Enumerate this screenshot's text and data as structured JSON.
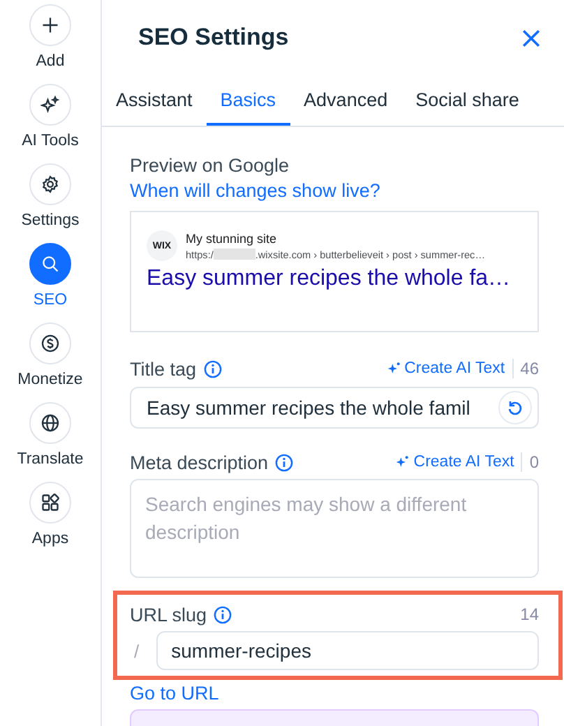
{
  "sidebar": {
    "items": [
      {
        "label": "Add",
        "selected": false
      },
      {
        "label": "AI Tools",
        "selected": false
      },
      {
        "label": "Settings",
        "selected": false
      },
      {
        "label": "SEO",
        "selected": true
      },
      {
        "label": "Monetize",
        "selected": false
      },
      {
        "label": "Translate",
        "selected": false
      },
      {
        "label": "Apps",
        "selected": false
      }
    ]
  },
  "panel": {
    "title": "SEO Settings",
    "tabs": [
      {
        "label": "Assistant",
        "selected": false
      },
      {
        "label": "Basics",
        "selected": true
      },
      {
        "label": "Advanced",
        "selected": false
      },
      {
        "label": "Social share",
        "selected": false
      }
    ],
    "preview": {
      "label": "Preview on Google",
      "link": "When will changes show live?",
      "favicon": "WIX",
      "site_name": "My stunning site",
      "url_start": "https:/",
      "url_end": ".wixsite.com › butterbelieveit › post › summer-rec…",
      "headline": "Easy summer recipes the whole fa…"
    },
    "fields": [
      {
        "kind": "input",
        "label": "Title tag",
        "ai_button": "Create AI Text",
        "count": "46",
        "value": "Easy summer recipes the whole famil",
        "highlighted": false
      },
      {
        "kind": "textarea",
        "label": "Meta description",
        "ai_button": "Create AI Text",
        "count": "0",
        "placeholder": "Search engines may show a different description",
        "highlighted": false
      },
      {
        "kind": "slug",
        "label": "URL slug",
        "count": "14",
        "prefix": "/",
        "value": "summer-recipes",
        "link": "Go to URL",
        "highlighted": true
      }
    ]
  }
}
